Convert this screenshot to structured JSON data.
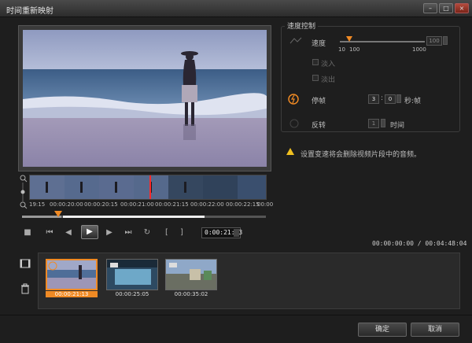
{
  "window": {
    "title": "时间重新映射",
    "controls": [
      "minimize-icon",
      "maximize-icon",
      "close-icon"
    ]
  },
  "timeline": {
    "ticks": [
      "19:15",
      "00:00:20:00",
      "00:00:20:15",
      "00:00:21:00",
      "00:00:21:15",
      "00:00:22:00",
      "00:00:22:15",
      "00:00"
    ],
    "timecode": "0:00:21:13",
    "in_bracket": "[",
    "out_bracket": "]"
  },
  "speed_panel": {
    "legend": "速度控制",
    "speed_label": "速度",
    "speed_value": "100",
    "speed_min_label": "10",
    "speed_mid_label": "100",
    "speed_max_label": "1000",
    "speed_fraction": 0.1,
    "fade_in_label": "淡入",
    "fade_out_label": "淡出",
    "freeze_label": "停帧",
    "freeze_value": "3",
    "freeze_frames": "0",
    "freeze_unit": "秒:帧",
    "reverse_label": "反转",
    "reverse_value": "1",
    "reverse_unit": "时间"
  },
  "warning": "设置变速将会删除视频片段中的音频。",
  "time_info": "00:00:00:00 / 00:04:48:04",
  "clips": [
    {
      "label": "00:00:21:13",
      "selected": true
    },
    {
      "label": "00:00:25:05",
      "selected": false
    },
    {
      "label": "00:00:35:02",
      "selected": false
    }
  ],
  "buttons": {
    "ok": "确定",
    "cancel": "取消"
  },
  "colors": {
    "accent": "#f08a24",
    "background": "#1e1e1e",
    "warning": "#f0c020"
  }
}
